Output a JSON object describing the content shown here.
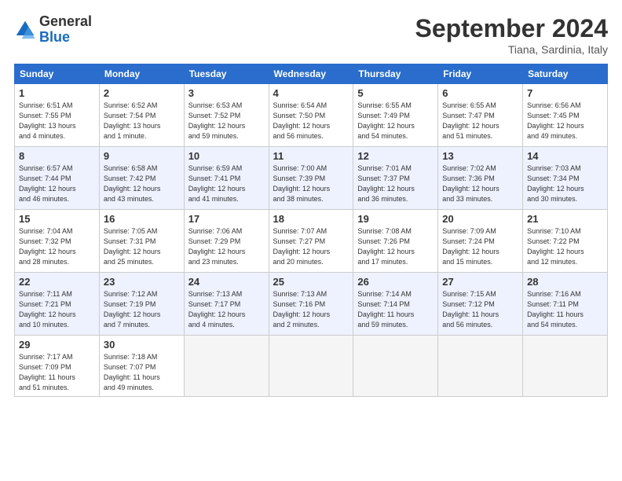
{
  "logo": {
    "general": "General",
    "blue": "Blue"
  },
  "title": "September 2024",
  "location": "Tiana, Sardinia, Italy",
  "days_of_week": [
    "Sunday",
    "Monday",
    "Tuesday",
    "Wednesday",
    "Thursday",
    "Friday",
    "Saturday"
  ],
  "weeks": [
    [
      {
        "num": "1",
        "info": "Sunrise: 6:51 AM\nSunset: 7:55 PM\nDaylight: 13 hours\nand 4 minutes."
      },
      {
        "num": "2",
        "info": "Sunrise: 6:52 AM\nSunset: 7:54 PM\nDaylight: 13 hours\nand 1 minute."
      },
      {
        "num": "3",
        "info": "Sunrise: 6:53 AM\nSunset: 7:52 PM\nDaylight: 12 hours\nand 59 minutes."
      },
      {
        "num": "4",
        "info": "Sunrise: 6:54 AM\nSunset: 7:50 PM\nDaylight: 12 hours\nand 56 minutes."
      },
      {
        "num": "5",
        "info": "Sunrise: 6:55 AM\nSunset: 7:49 PM\nDaylight: 12 hours\nand 54 minutes."
      },
      {
        "num": "6",
        "info": "Sunrise: 6:55 AM\nSunset: 7:47 PM\nDaylight: 12 hours\nand 51 minutes."
      },
      {
        "num": "7",
        "info": "Sunrise: 6:56 AM\nSunset: 7:45 PM\nDaylight: 12 hours\nand 49 minutes."
      }
    ],
    [
      {
        "num": "8",
        "info": "Sunrise: 6:57 AM\nSunset: 7:44 PM\nDaylight: 12 hours\nand 46 minutes."
      },
      {
        "num": "9",
        "info": "Sunrise: 6:58 AM\nSunset: 7:42 PM\nDaylight: 12 hours\nand 43 minutes."
      },
      {
        "num": "10",
        "info": "Sunrise: 6:59 AM\nSunset: 7:41 PM\nDaylight: 12 hours\nand 41 minutes."
      },
      {
        "num": "11",
        "info": "Sunrise: 7:00 AM\nSunset: 7:39 PM\nDaylight: 12 hours\nand 38 minutes."
      },
      {
        "num": "12",
        "info": "Sunrise: 7:01 AM\nSunset: 7:37 PM\nDaylight: 12 hours\nand 36 minutes."
      },
      {
        "num": "13",
        "info": "Sunrise: 7:02 AM\nSunset: 7:36 PM\nDaylight: 12 hours\nand 33 minutes."
      },
      {
        "num": "14",
        "info": "Sunrise: 7:03 AM\nSunset: 7:34 PM\nDaylight: 12 hours\nand 30 minutes."
      }
    ],
    [
      {
        "num": "15",
        "info": "Sunrise: 7:04 AM\nSunset: 7:32 PM\nDaylight: 12 hours\nand 28 minutes."
      },
      {
        "num": "16",
        "info": "Sunrise: 7:05 AM\nSunset: 7:31 PM\nDaylight: 12 hours\nand 25 minutes."
      },
      {
        "num": "17",
        "info": "Sunrise: 7:06 AM\nSunset: 7:29 PM\nDaylight: 12 hours\nand 23 minutes."
      },
      {
        "num": "18",
        "info": "Sunrise: 7:07 AM\nSunset: 7:27 PM\nDaylight: 12 hours\nand 20 minutes."
      },
      {
        "num": "19",
        "info": "Sunrise: 7:08 AM\nSunset: 7:26 PM\nDaylight: 12 hours\nand 17 minutes."
      },
      {
        "num": "20",
        "info": "Sunrise: 7:09 AM\nSunset: 7:24 PM\nDaylight: 12 hours\nand 15 minutes."
      },
      {
        "num": "21",
        "info": "Sunrise: 7:10 AM\nSunset: 7:22 PM\nDaylight: 12 hours\nand 12 minutes."
      }
    ],
    [
      {
        "num": "22",
        "info": "Sunrise: 7:11 AM\nSunset: 7:21 PM\nDaylight: 12 hours\nand 10 minutes."
      },
      {
        "num": "23",
        "info": "Sunrise: 7:12 AM\nSunset: 7:19 PM\nDaylight: 12 hours\nand 7 minutes."
      },
      {
        "num": "24",
        "info": "Sunrise: 7:13 AM\nSunset: 7:17 PM\nDaylight: 12 hours\nand 4 minutes."
      },
      {
        "num": "25",
        "info": "Sunrise: 7:13 AM\nSunset: 7:16 PM\nDaylight: 12 hours\nand 2 minutes."
      },
      {
        "num": "26",
        "info": "Sunrise: 7:14 AM\nSunset: 7:14 PM\nDaylight: 11 hours\nand 59 minutes."
      },
      {
        "num": "27",
        "info": "Sunrise: 7:15 AM\nSunset: 7:12 PM\nDaylight: 11 hours\nand 56 minutes."
      },
      {
        "num": "28",
        "info": "Sunrise: 7:16 AM\nSunset: 7:11 PM\nDaylight: 11 hours\nand 54 minutes."
      }
    ],
    [
      {
        "num": "29",
        "info": "Sunrise: 7:17 AM\nSunset: 7:09 PM\nDaylight: 11 hours\nand 51 minutes."
      },
      {
        "num": "30",
        "info": "Sunrise: 7:18 AM\nSunset: 7:07 PM\nDaylight: 11 hours\nand 49 minutes."
      },
      null,
      null,
      null,
      null,
      null
    ]
  ]
}
